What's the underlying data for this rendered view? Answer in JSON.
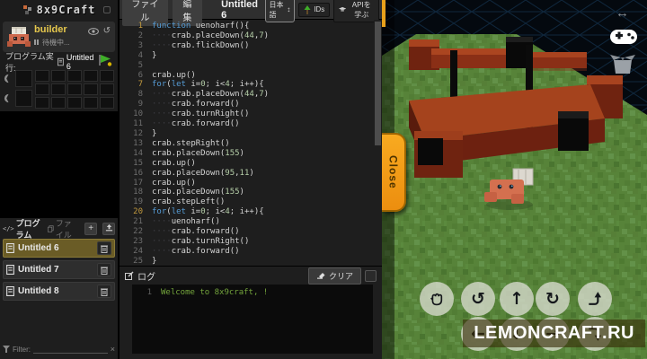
{
  "sidebar": {
    "logo_text": "8x9Craft",
    "robot_card": {
      "name": "builder",
      "status": "待機中..."
    },
    "run_label": "プログラム実行:",
    "run_target": "Untitled 6",
    "programs": {
      "tab_program": "プログラム",
      "tab_file": "ファイル",
      "tab_code_glyph": "</>",
      "add_label": "+",
      "items": [
        {
          "label": "Untitled 6",
          "selected": true
        },
        {
          "label": "Untitled 7",
          "selected": false
        },
        {
          "label": "Untitled 8",
          "selected": false
        }
      ],
      "filter_label": "Filter:",
      "filter_clear": "×"
    }
  },
  "topbar": {
    "file_menu": "ファイル",
    "edit_menu": "編集",
    "title": "Untitled 6",
    "language": "日本語",
    "lang_arrows": "↕",
    "ids_label": "IDs",
    "api_label": "APIを学ぶ"
  },
  "editor": {
    "code_lines": [
      {
        "n": 1,
        "g": true,
        "s": [
          [
            "kw",
            "function"
          ],
          [
            "p",
            " uenoharf(){"
          ]
        ]
      },
      {
        "n": 2,
        "g": false,
        "s": [
          [
            "w",
            "····"
          ],
          [
            "p",
            "crab.placeDown("
          ],
          [
            "n",
            "44"
          ],
          [
            "p",
            ","
          ],
          [
            "n",
            "7"
          ],
          [
            "p",
            ")"
          ]
        ]
      },
      {
        "n": 3,
        "g": false,
        "s": [
          [
            "w",
            "····"
          ],
          [
            "p",
            "crab.flickDown()"
          ]
        ]
      },
      {
        "n": 4,
        "g": false,
        "s": [
          [
            "p",
            "}"
          ]
        ]
      },
      {
        "n": 5,
        "g": false,
        "s": [
          [
            "p",
            ""
          ]
        ]
      },
      {
        "n": 6,
        "g": false,
        "s": [
          [
            "p",
            "crab.up()"
          ]
        ]
      },
      {
        "n": 7,
        "g": true,
        "s": [
          [
            "kw",
            "for"
          ],
          [
            "p",
            "("
          ],
          [
            "kw",
            "let"
          ],
          [
            "p",
            " i="
          ],
          [
            "n",
            "0"
          ],
          [
            "p",
            "; i<"
          ],
          [
            "n",
            "4"
          ],
          [
            "p",
            "; i++){"
          ]
        ]
      },
      {
        "n": 8,
        "g": false,
        "s": [
          [
            "w",
            "····"
          ],
          [
            "p",
            "crab.placeDown("
          ],
          [
            "n",
            "44"
          ],
          [
            "p",
            ","
          ],
          [
            "n",
            "7"
          ],
          [
            "p",
            ")"
          ]
        ]
      },
      {
        "n": 9,
        "g": false,
        "s": [
          [
            "w",
            "····"
          ],
          [
            "p",
            "crab.forward()"
          ]
        ]
      },
      {
        "n": 10,
        "g": false,
        "s": [
          [
            "w",
            "····"
          ],
          [
            "p",
            "crab.turnRight()"
          ]
        ]
      },
      {
        "n": 11,
        "g": false,
        "s": [
          [
            "w",
            "····"
          ],
          [
            "p",
            "crab.forward()"
          ]
        ]
      },
      {
        "n": 12,
        "g": false,
        "s": [
          [
            "p",
            "}"
          ]
        ]
      },
      {
        "n": 13,
        "g": false,
        "s": [
          [
            "p",
            "crab.stepRight()"
          ]
        ]
      },
      {
        "n": 14,
        "g": false,
        "s": [
          [
            "p",
            "crab.placeDown("
          ],
          [
            "n",
            "155"
          ],
          [
            "p",
            ")"
          ]
        ]
      },
      {
        "n": 15,
        "g": false,
        "s": [
          [
            "p",
            "crab.up()"
          ]
        ]
      },
      {
        "n": 16,
        "g": false,
        "s": [
          [
            "p",
            "crab.placeDown("
          ],
          [
            "n",
            "95"
          ],
          [
            "p",
            ","
          ],
          [
            "n",
            "11"
          ],
          [
            "p",
            ")"
          ]
        ]
      },
      {
        "n": 17,
        "g": false,
        "s": [
          [
            "p",
            "crab.up()"
          ]
        ]
      },
      {
        "n": 18,
        "g": false,
        "s": [
          [
            "p",
            "crab.placeDown("
          ],
          [
            "n",
            "155"
          ],
          [
            "p",
            ")"
          ]
        ]
      },
      {
        "n": 19,
        "g": false,
        "s": [
          [
            "p",
            "crab.stepLeft()"
          ]
        ]
      },
      {
        "n": 20,
        "g": true,
        "s": [
          [
            "kw",
            "for"
          ],
          [
            "p",
            "("
          ],
          [
            "kw",
            "let"
          ],
          [
            "p",
            " i="
          ],
          [
            "n",
            "0"
          ],
          [
            "p",
            "; i<"
          ],
          [
            "n",
            "4"
          ],
          [
            "p",
            "; i++){"
          ]
        ]
      },
      {
        "n": 21,
        "g": false,
        "s": [
          [
            "w",
            "····"
          ],
          [
            "p",
            "uenoharf()"
          ]
        ]
      },
      {
        "n": 22,
        "g": false,
        "s": [
          [
            "w",
            "····"
          ],
          [
            "p",
            "crab.forward()"
          ]
        ]
      },
      {
        "n": 23,
        "g": false,
        "s": [
          [
            "w",
            "····"
          ],
          [
            "p",
            "crab.turnRight()"
          ]
        ]
      },
      {
        "n": 24,
        "g": false,
        "s": [
          [
            "w",
            "····"
          ],
          [
            "p",
            "crab.forward()"
          ]
        ]
      },
      {
        "n": 25,
        "g": false,
        "s": [
          [
            "p",
            "}"
          ]
        ]
      }
    ]
  },
  "log": {
    "title": "ログ",
    "clear_label": "クリア",
    "lines": [
      {
        "n": "1",
        "text": "Welcome to 8x9craft, !"
      }
    ]
  },
  "game": {
    "close_label": "Close",
    "watermark": "LEMONCRAFT.RU",
    "resize_glyph": "↔"
  },
  "colors": {
    "accent_orange": "#f0a01c",
    "keyword_blue": "#569cd6",
    "number_green": "#b5cea8",
    "log_green": "#74a53c",
    "selected_olive": "#6a5c26",
    "grass_green": "#578339",
    "block_red": "#9c3a1c"
  }
}
